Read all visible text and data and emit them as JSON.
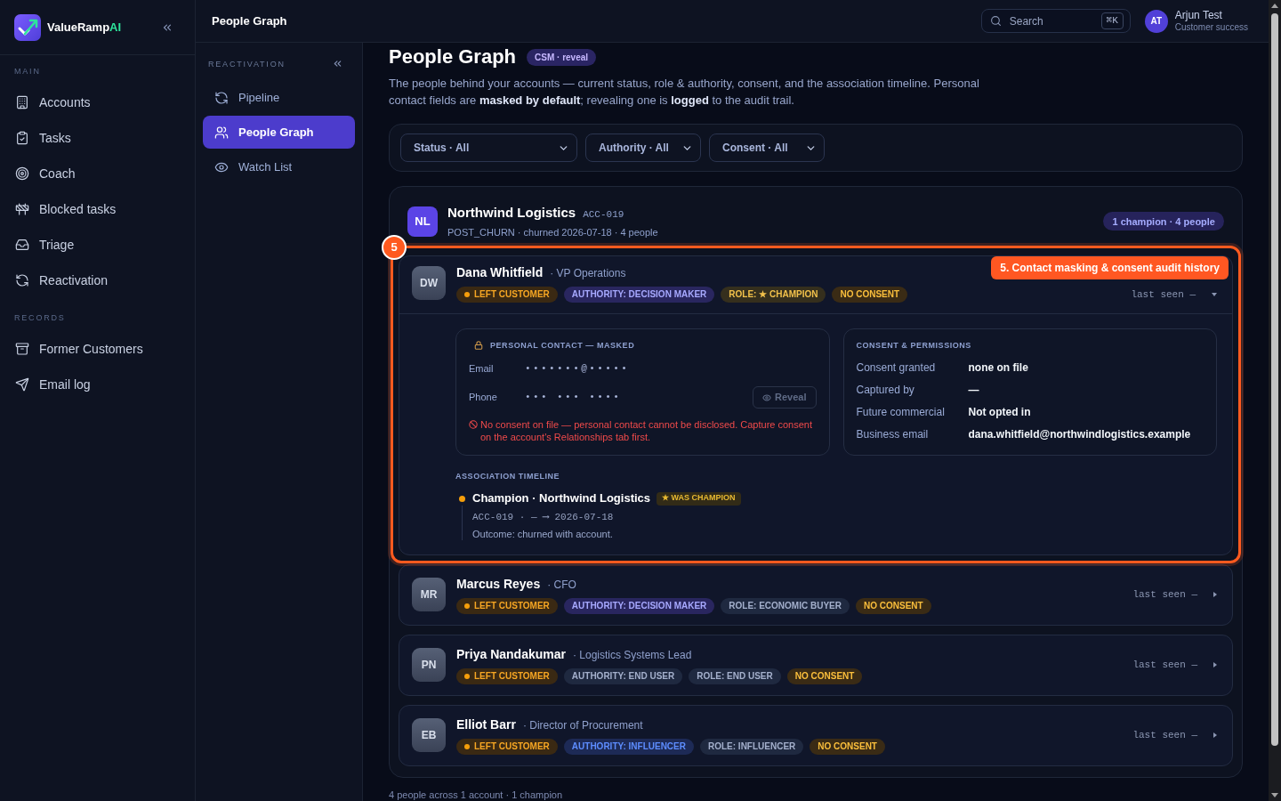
{
  "sidebar": {
    "brand": {
      "name": "ValueRamp",
      "accent": "AI"
    },
    "sections": [
      {
        "label": "MAIN",
        "items": [
          {
            "label": "Accounts",
            "selected": false
          },
          {
            "label": "Tasks",
            "selected": false
          },
          {
            "label": "Coach",
            "selected": false
          },
          {
            "label": "Blocked tasks",
            "selected": false
          },
          {
            "label": "Triage",
            "selected": false
          },
          {
            "label": "Reactivation",
            "selected": false
          }
        ]
      },
      {
        "label": "RECORDS",
        "items": [
          {
            "label": "Former Customers",
            "selected": false
          },
          {
            "label": "Email log",
            "selected": false
          }
        ]
      }
    ]
  },
  "subnav": {
    "title": "REACTIVATION",
    "items": [
      {
        "label": "Pipeline",
        "selected": false
      },
      {
        "label": "People Graph",
        "selected": true
      },
      {
        "label": "Watch List",
        "selected": false
      }
    ]
  },
  "topbar": {
    "title": "People Graph",
    "search": {
      "placeholder": "Search",
      "shortcut": "⌘K"
    },
    "user": {
      "initials": "AT",
      "name": "Arjun Test",
      "role": "Customer success"
    }
  },
  "page": {
    "title": "People Graph",
    "badge": "CSM · reveal",
    "description": "The people behind your accounts — current status, role & authority, consent, and the association timeline. Personal contact fields are **masked by default**; revealing one is **logged** to the audit trail."
  },
  "filters": [
    "Status · All",
    "Authority · All",
    "Consent · All"
  ],
  "accounts": [
    {
      "initials": "NL",
      "name": "Northwind Logistics",
      "id": "ACC-019",
      "meta": "POST_CHURN · churned 2026-07-18 · 4 people",
      "summary": "1 champion · 4 people",
      "people": [
        {
          "initials": "DW",
          "name": "Dana Whitfield",
          "title": "· VP Operations",
          "expanded": true,
          "last_seen": "last seen —",
          "tags": [
            {
              "kind": "status",
              "label": "LEFT CUSTOMER"
            },
            {
              "kind": "authority",
              "label": "AUTHORITY: DECISION MAKER"
            },
            {
              "kind": "champion",
              "label": "ROLE: ★ CHAMPION"
            },
            {
              "kind": "consent",
              "label": "NO CONSENT"
            }
          ],
          "callout": {
            "number": "5",
            "label": "5. Contact masking & consent audit history"
          },
          "details": {
            "contact": {
              "title": "PERSONAL CONTACT — MASKED",
              "fields": [
                {
                  "label": "Email",
                  "value": "•••••••@•••••"
                },
                {
                  "label": "Phone",
                  "value": "••• ••• ••••"
                }
              ],
              "reveal": {
                "label": "Reveal",
                "disabled": true
              },
              "warning": "No consent on file — personal contact cannot be disclosed. Capture consent on the account's Relationships tab first."
            },
            "consent": {
              "title": "CONSENT & PERMISSIONS",
              "rows": [
                {
                  "label": "Consent granted",
                  "value": "none on file"
                },
                {
                  "label": "Captured by",
                  "value": "—"
                },
                {
                  "label": "Future commercial",
                  "value": "Not opted in"
                },
                {
                  "label": "Business email",
                  "value": "dana.whitfield@northwindlogistics.example"
                }
              ]
            },
            "timeline": {
              "title": "ASSOCIATION TIMELINE",
              "entries": [
                {
                  "title": "Champion · Northwind Logistics",
                  "badge": "★ WAS CHAMPION",
                  "span": "ACC-019 · — ⟶ 2026-07-18",
                  "outcome": "Outcome: churned with account."
                }
              ]
            }
          }
        },
        {
          "initials": "MR",
          "name": "Marcus Reyes",
          "title": "· CFO",
          "expanded": false,
          "last_seen": "last seen —",
          "tags": [
            {
              "kind": "status",
              "label": "LEFT CUSTOMER"
            },
            {
              "kind": "authority",
              "label": "AUTHORITY: DECISION MAKER"
            },
            {
              "kind": "neutral",
              "label": "ROLE: ECONOMIC BUYER"
            },
            {
              "kind": "consent",
              "label": "NO CONSENT"
            }
          ]
        },
        {
          "initials": "PN",
          "name": "Priya Nandakumar",
          "title": "· Logistics Systems Lead",
          "expanded": false,
          "last_seen": "last seen —",
          "tags": [
            {
              "kind": "status",
              "label": "LEFT CUSTOMER"
            },
            {
              "kind": "neutral",
              "label": "AUTHORITY: END USER"
            },
            {
              "kind": "neutral",
              "label": "ROLE: END USER"
            },
            {
              "kind": "consent",
              "label": "NO CONSENT"
            }
          ]
        },
        {
          "initials": "EB",
          "name": "Elliot Barr",
          "title": "· Director of Procurement",
          "expanded": false,
          "last_seen": "last seen —",
          "tags": [
            {
              "kind": "status",
              "label": "LEFT CUSTOMER"
            },
            {
              "kind": "influencer",
              "label": "AUTHORITY: INFLUENCER"
            },
            {
              "kind": "neutral",
              "label": "ROLE: INFLUENCER"
            },
            {
              "kind": "consent",
              "label": "NO CONSENT"
            }
          ]
        }
      ]
    }
  ],
  "footer": "4 people across 1 account · 1 champion"
}
